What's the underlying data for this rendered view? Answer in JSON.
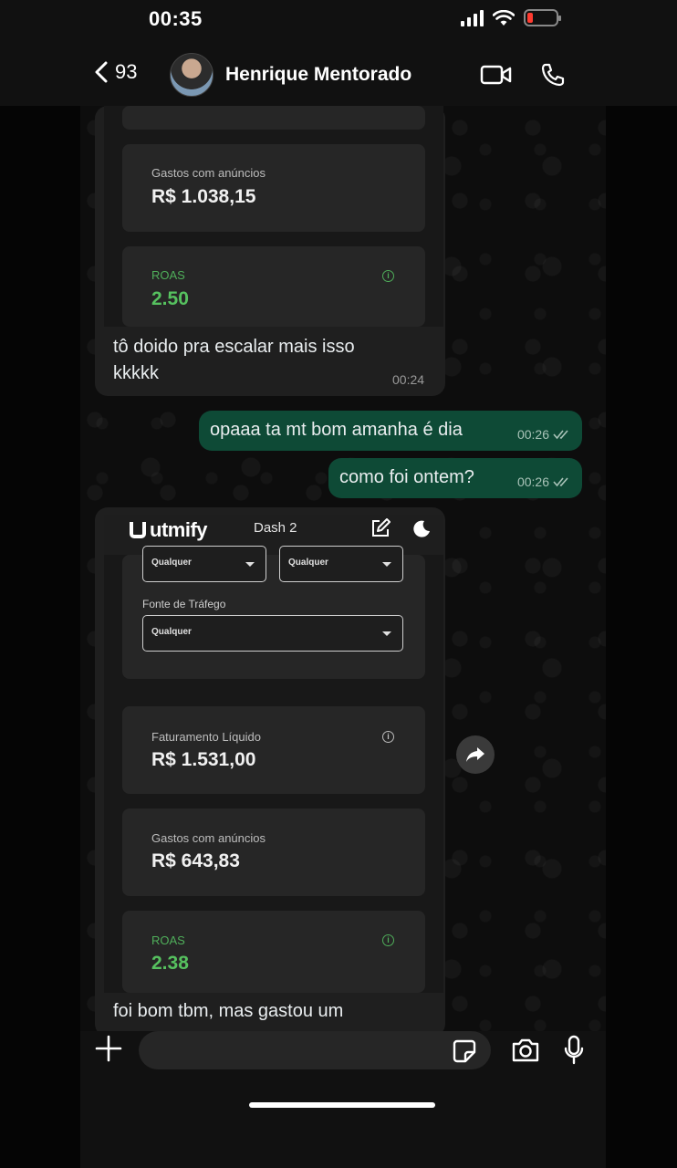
{
  "status_bar": {
    "time": "00:35"
  },
  "header": {
    "back_count": "93",
    "contact_name": "Henrique Mentorado"
  },
  "message1": {
    "cards": [
      {
        "label": "Gastos com anúncios",
        "value": "R$ 1.038,15"
      },
      {
        "label": "ROAS",
        "value": "2.50"
      }
    ],
    "caption_line1": "tô doido pra escalar mais isso",
    "caption_line2": "kkkkk",
    "time": "00:24"
  },
  "out_messages": [
    {
      "text": "opaaa ta mt bom amanha é dia",
      "time": "00:26"
    },
    {
      "text": "como foi ontem?",
      "time": "00:26"
    }
  ],
  "message2": {
    "app": {
      "logo": "utmify",
      "dashboard": "Dash 2"
    },
    "selects": [
      {
        "value": "Qualquer"
      },
      {
        "value": "Qualquer"
      }
    ],
    "traffic_source": {
      "label": "Fonte de Tráfego",
      "value": "Qualquer"
    },
    "cards": [
      {
        "label": "Faturamento Líquido",
        "value": "R$ 1.531,00"
      },
      {
        "label": "Gastos com anúncios",
        "value": "R$ 643,83"
      },
      {
        "label": "ROAS",
        "value": "2.38"
      }
    ],
    "caption": "foi bom tbm, mas gastou um"
  },
  "input_bar": {
    "placeholder": ""
  },
  "colors": {
    "outgoing_bubble": "#0e4a36",
    "roas_green": "#56c15f",
    "incoming_bubble": "#1f1f1f"
  }
}
